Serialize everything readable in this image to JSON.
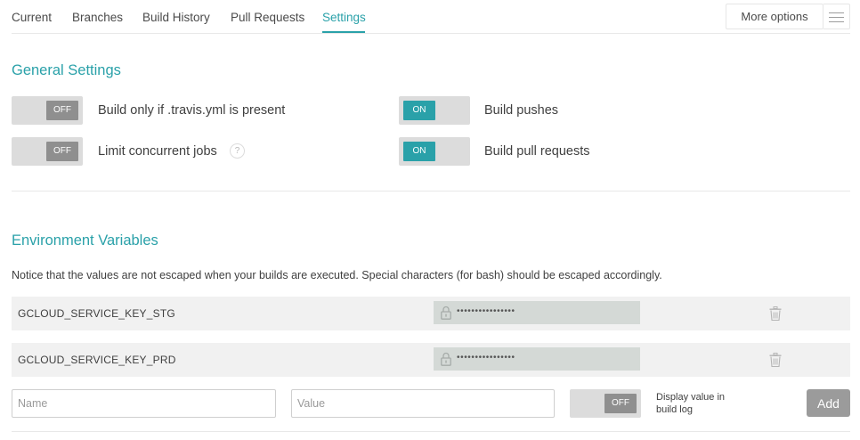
{
  "nav": {
    "tabs": [
      {
        "label": "Current"
      },
      {
        "label": "Branches"
      },
      {
        "label": "Build History"
      },
      {
        "label": "Pull Requests"
      },
      {
        "label": "Settings",
        "active": true
      }
    ],
    "more_options_label": "More options",
    "menu_icon": "hamburger-icon"
  },
  "general_settings": {
    "title": "General Settings",
    "toggles": [
      {
        "label": "Build only if .travis.yml is present",
        "state": "OFF"
      },
      {
        "label": "Build pushes",
        "state": "ON"
      },
      {
        "label": "Limit concurrent jobs",
        "state": "OFF",
        "help": "?"
      },
      {
        "label": "Build pull requests",
        "state": "ON"
      }
    ]
  },
  "env_vars": {
    "title": "Environment Variables",
    "notice": "Notice that the values are not escaped when your builds are executed. Special characters (for bash) should be escaped accordingly.",
    "rows": [
      {
        "name": "GCLOUD_SERVICE_KEY_STG",
        "value": "••••••••••••••••"
      },
      {
        "name": "GCLOUD_SERVICE_KEY_PRD",
        "value": "••••••••••••••••"
      }
    ],
    "form": {
      "name_placeholder": "Name",
      "value_placeholder": "Value",
      "display_toggle_state": "OFF",
      "display_label": "Display value in build log",
      "add_label": "Add"
    }
  },
  "colors": {
    "accent": "#2aa1a9",
    "toggle_off": "#8f8f8f",
    "toggle_track": "#dcdcdc",
    "row_bg": "#f1f1f1",
    "value_bg": "#d4d9d6",
    "add_button": "#9b9b9b"
  }
}
